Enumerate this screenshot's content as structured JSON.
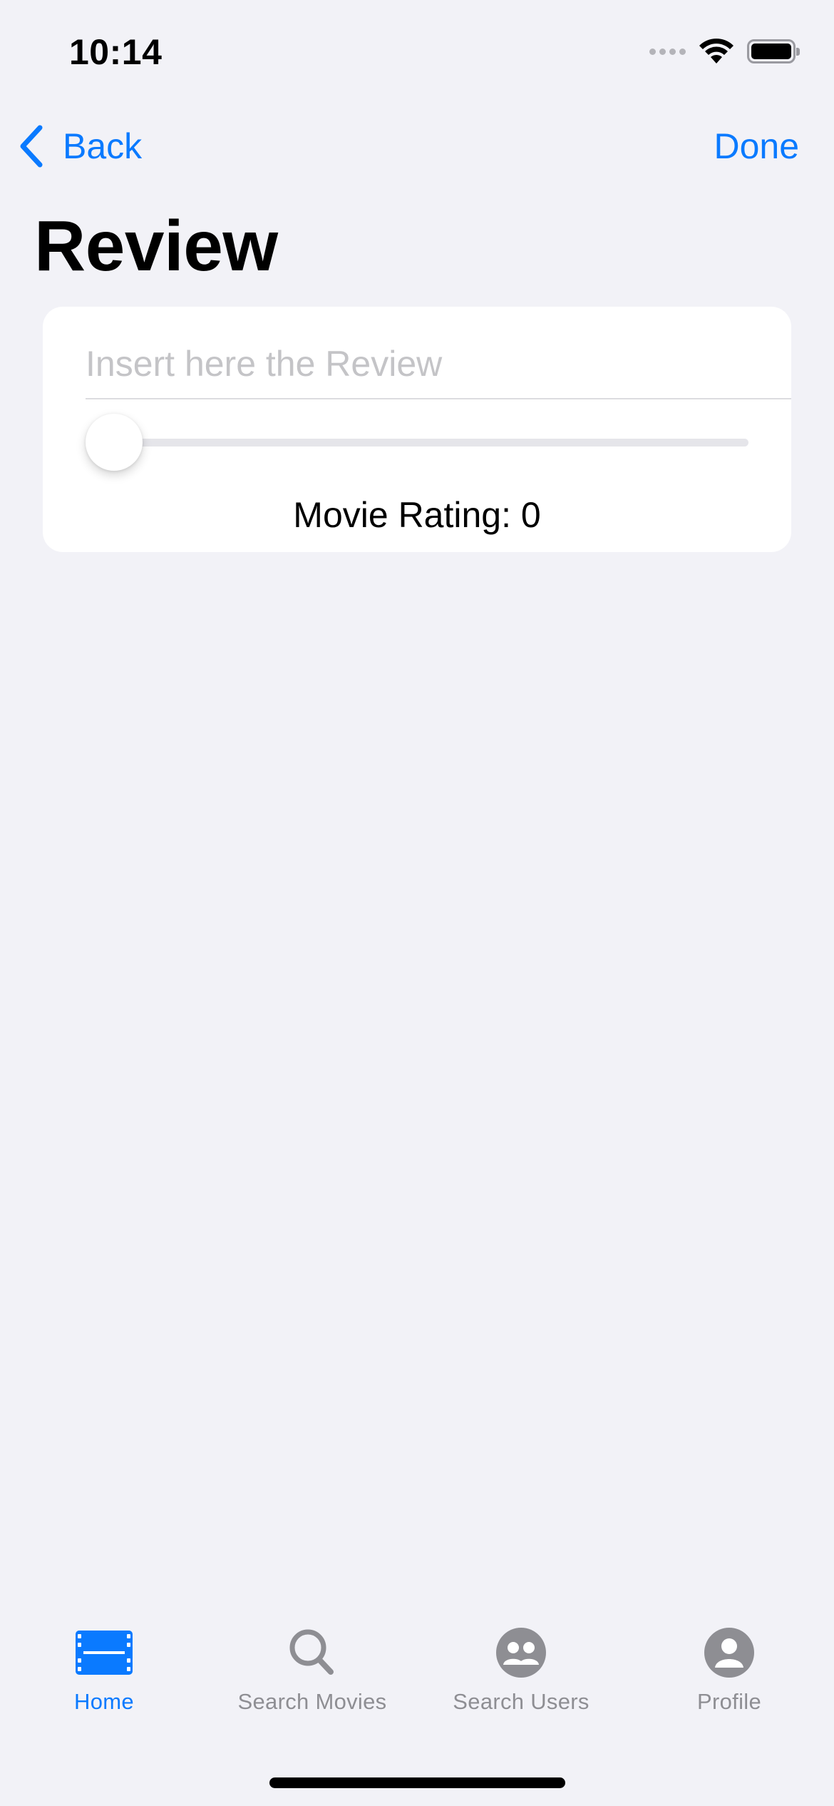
{
  "status_bar": {
    "time": "10:14",
    "icons": [
      "signal-dots-icon",
      "wifi-icon",
      "battery-icon"
    ]
  },
  "nav": {
    "back_label": "Back",
    "done_label": "Done",
    "title": "Review"
  },
  "review_form": {
    "review_placeholder": "Insert here the Review",
    "review_value": "",
    "rating_label": "Movie Rating: 0",
    "rating_value": 0
  },
  "tab_bar": {
    "tabs": [
      {
        "label": "Home",
        "icon": "film-icon",
        "active": true
      },
      {
        "label": "Search Movies",
        "icon": "magnifier-icon",
        "active": false
      },
      {
        "label": "Search Users",
        "icon": "users-icon",
        "active": false
      },
      {
        "label": "Profile",
        "icon": "profile-icon",
        "active": false
      }
    ]
  },
  "colors": {
    "accent": "#0a7aff",
    "background": "#f2f2f7",
    "inactive_tab": "#8e8e93"
  }
}
